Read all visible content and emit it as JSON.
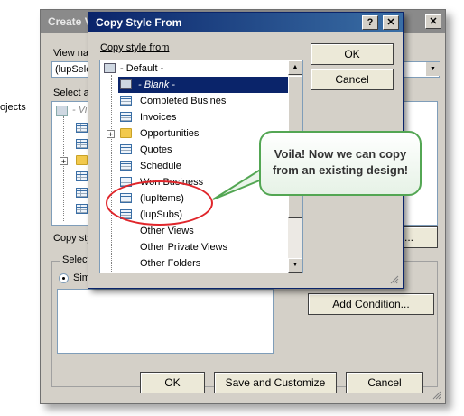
{
  "left_fragment": {
    "text": "ojects"
  },
  "background_dialog": {
    "title": "Create V",
    "view_name_label": "View nar",
    "view_name_value": "(lupSele",
    "select_label": "Select a",
    "tree_first_item": "- Vi",
    "copy_style_label": "Copy sty",
    "copy_style_button": "m...",
    "select_group_label": "Select",
    "radio_label": "Sim",
    "add_condition_button": "Add Condition...",
    "ok_button": "OK",
    "save_customize_button": "Save and Customize",
    "cancel_button": "Cancel"
  },
  "copy_style_dialog": {
    "title": "Copy Style From",
    "help_button": "?",
    "close_button": "✕",
    "list_label": "Copy style from",
    "ok_button": "OK",
    "cancel_button": "Cancel",
    "tree_items": [
      {
        "label": "- Default -",
        "icon": "default-view-icon"
      },
      {
        "label": "- Blank -",
        "icon": "blank-view-icon",
        "selected": true
      },
      {
        "label": "Completed Busines",
        "icon": "table-view-icon"
      },
      {
        "label": "Invoices",
        "icon": "table-view-icon"
      },
      {
        "label": "Opportunities",
        "icon": "folder-icon",
        "expander": "+"
      },
      {
        "label": "Quotes",
        "icon": "table-view-icon"
      },
      {
        "label": "Schedule",
        "icon": "table-view-icon"
      },
      {
        "label": "Won Business",
        "icon": "table-view-icon"
      },
      {
        "label": "(lupItems)",
        "icon": "table-view-icon"
      },
      {
        "label": "(lupSubs)",
        "icon": "table-view-icon"
      },
      {
        "label": "Other Views",
        "icon": "none"
      },
      {
        "label": "Other Private Views",
        "icon": "none"
      },
      {
        "label": "Other Folders",
        "icon": "none"
      }
    ]
  },
  "callout": {
    "line1": "Voila! Now we can copy",
    "line2": "from an existing design!"
  },
  "colors": {
    "title_active": "#0a246a",
    "callout_border": "#53a653",
    "highlight_ellipse": "#e0262b"
  }
}
